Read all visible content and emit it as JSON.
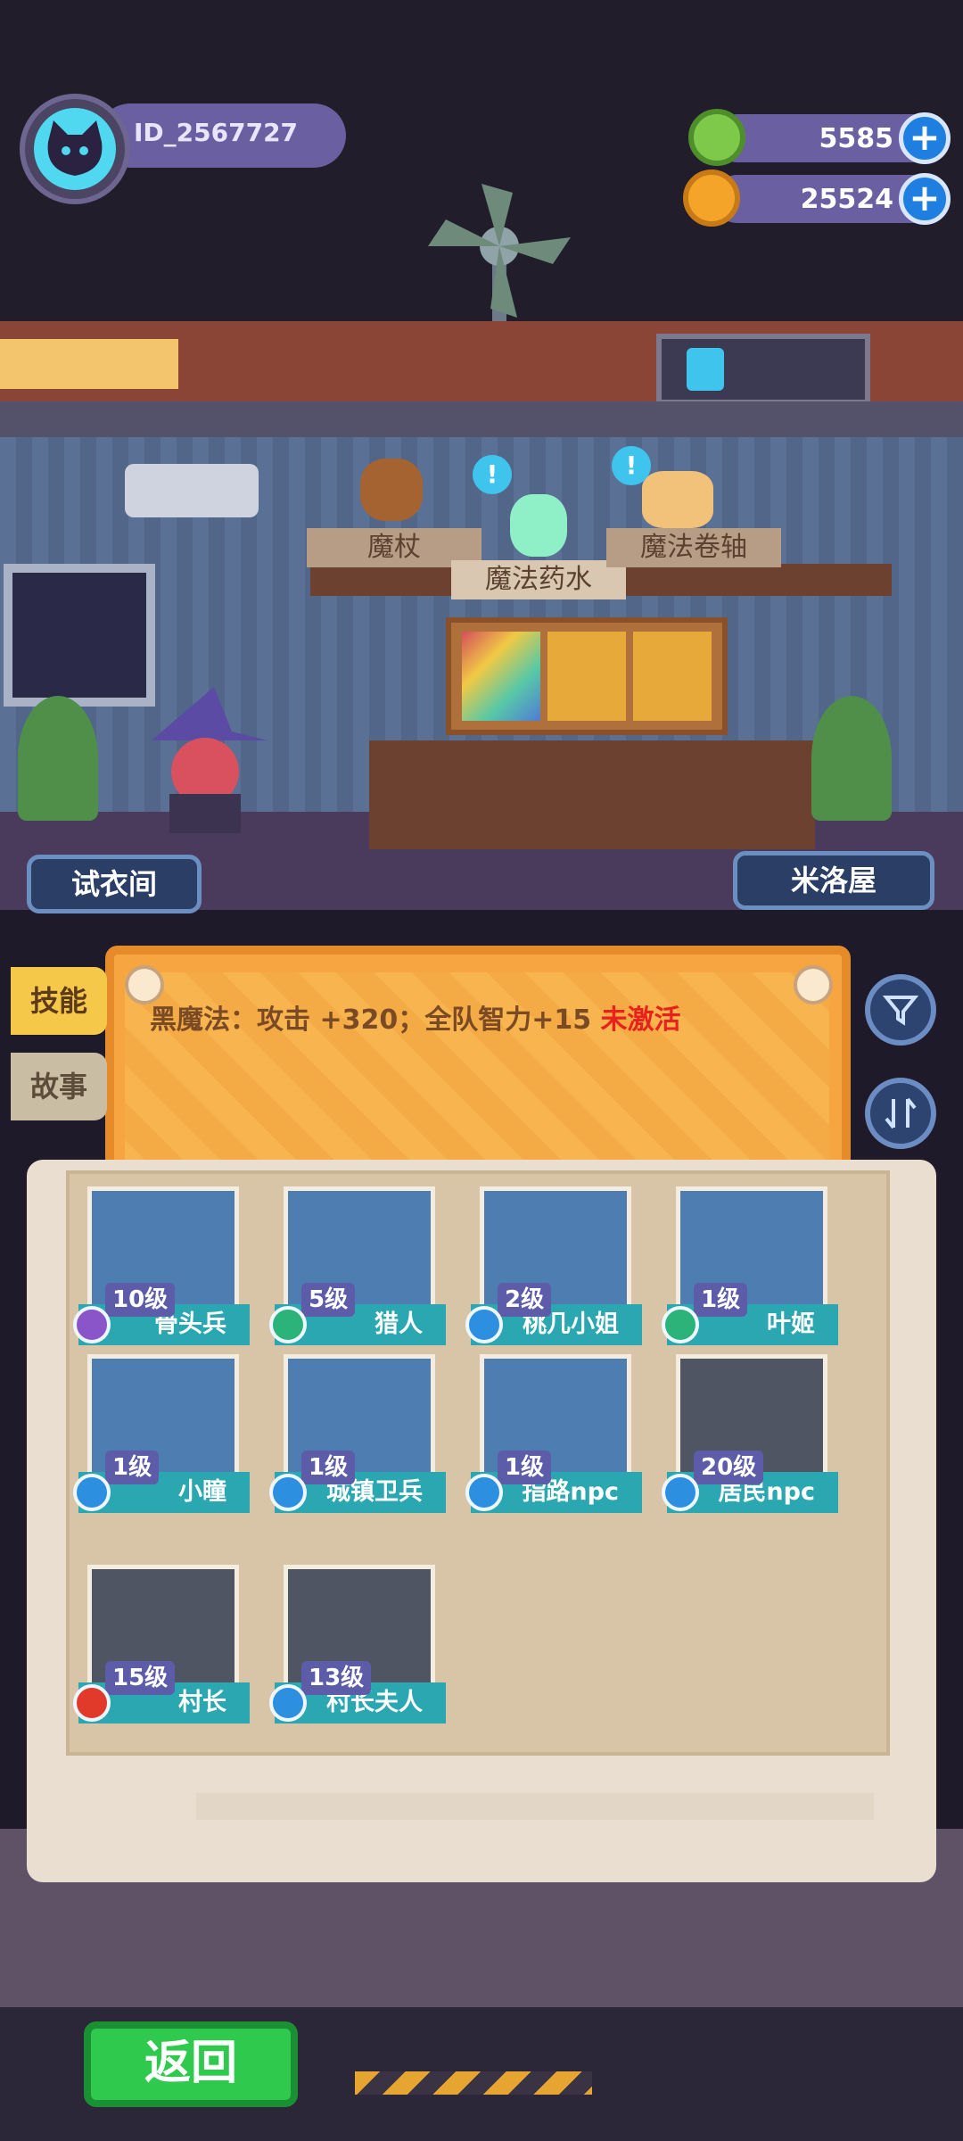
{
  "player": {
    "id_label": "ID_2567727"
  },
  "currencies": [
    {
      "name": "green-gem",
      "value": "5585",
      "color": "#7ec84a"
    },
    {
      "name": "gold-planet",
      "value": "25524",
      "color": "#f5a42a"
    }
  ],
  "room": {
    "shelf_signs": [
      "魔杖",
      "魔法药水",
      "魔法卷轴"
    ],
    "left_nav": "试衣间",
    "right_nav": "米洛屋"
  },
  "tabs": {
    "skill": "技能",
    "story": "故事"
  },
  "skill": {
    "text": "黑魔法：攻击 +320；全队智力+15",
    "status": "未激活"
  },
  "characters": [
    {
      "level": "10级",
      "name": "骨头兵",
      "class_color": "#8a55c9",
      "portrait_color": "#4d7db1"
    },
    {
      "level": "5级",
      "name": "猎人",
      "class_color": "#2bb37a",
      "portrait_color": "#4d7db1"
    },
    {
      "level": "2级",
      "name": "桃几小姐",
      "class_color": "#2d8fe0",
      "portrait_color": "#4d7db1"
    },
    {
      "level": "1级",
      "name": "叶姬",
      "class_color": "#2bb37a",
      "portrait_color": "#4d7db1"
    },
    {
      "level": "1级",
      "name": "小瞳",
      "class_color": "#2d8fe0",
      "portrait_color": "#4d7db1"
    },
    {
      "level": "1级",
      "name": "城镇卫兵",
      "class_color": "#2d8fe0",
      "portrait_color": "#4d7db1"
    },
    {
      "level": "1级",
      "name": "指路npc",
      "class_color": "#2d8fe0",
      "portrait_color": "#4d7db1"
    },
    {
      "level": "20级",
      "name": "居民npc",
      "class_color": "#2d8fe0",
      "portrait_color": "#505563"
    },
    {
      "level": "15级",
      "name": "村长",
      "class_color": "#e23a2a",
      "portrait_color": "#505563"
    },
    {
      "level": "13级",
      "name": "村长夫人",
      "class_color": "#2d8fe0",
      "portrait_color": "#505563"
    }
  ],
  "bottom": {
    "back_label": "返回"
  }
}
